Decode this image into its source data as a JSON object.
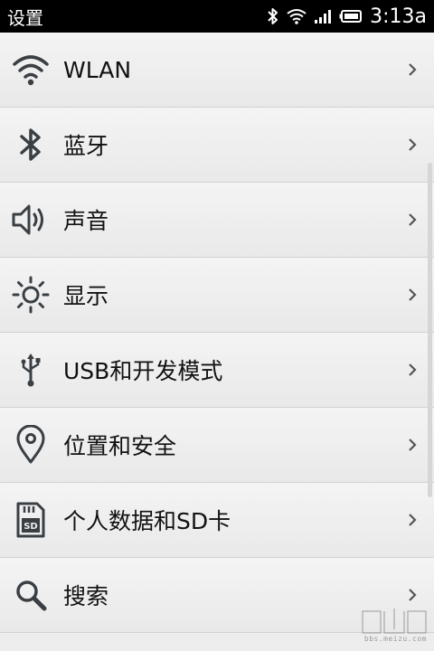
{
  "status_bar": {
    "title": "设置",
    "time": "3:13a",
    "icons": [
      "bluetooth-icon",
      "wifi-icon",
      "signal-icon",
      "battery-icon"
    ]
  },
  "settings": {
    "items": [
      {
        "label": "WLAN",
        "icon": "wifi-icon"
      },
      {
        "label": "蓝牙",
        "icon": "bluetooth-icon"
      },
      {
        "label": "声音",
        "icon": "speaker-icon"
      },
      {
        "label": "显示",
        "icon": "brightness-icon"
      },
      {
        "label": "USB和开发模式",
        "icon": "usb-icon"
      },
      {
        "label": "位置和安全",
        "icon": "location-pin-icon"
      },
      {
        "label": "个人数据和SD卡",
        "icon": "sd-card-icon"
      },
      {
        "label": "搜索",
        "icon": "search-icon"
      }
    ]
  },
  "watermark": {
    "text": "bbs.meizu.com"
  },
  "colors": {
    "status_bar_bg": "#000000",
    "row_bg": "#efefef",
    "icon_gray": "#3a3f44"
  }
}
